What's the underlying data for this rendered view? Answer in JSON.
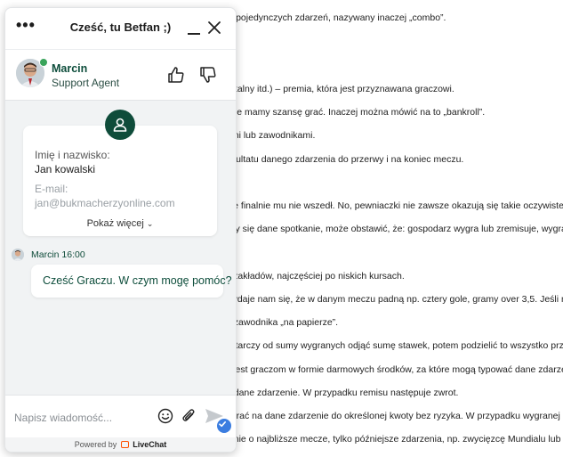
{
  "article": {
    "lines": [
      "le pojedynczych zdarzeń, nazywany inaczej „combo”.",
      "witalny itd.) – premia, która jest przyznawana graczowi.",
      "tóre mamy szansę grać. Inaczej można mówić na to „bankroll”.",
      "ami lub zawodnikami.",
      "ezultatu danego zdarzenia do przerwy i na koniec meczu.",
      "ale finalnie mu nie wszedł. No, pewniaczki nie zawsze okazują się takie oczywiste, jak",
      "czy się dane spotkanie, może obstawić, że: gospodarz wygra lub zremisuje, wygra gość",
      "ć zakładów, najczęściej po niskich kursach.",
      "wydaje nam się, że w danym meczu padną np. cztery gole, gramy over 3,5. Jeśli nat",
      "o zawodnika „na papierze”.",
      "ystarczy od sumy wygranych odjąć sumę stawek, potem podzielić to wszystko przez",
      "y jest graczom w formie darmowych środków, za które mogą typować dane zdarzen",
      "a dane zdarzenie. W przypadku remisu następuje zwrot.",
      "agrać na dane zdarzenie do określonej kwoty bez ryzyka. W przypadku wygranej salo",
      "g nie o najbliższe mecze, tylko późniejsze zdarzenia, np. zwycięzcę Mundialu lub króla"
    ]
  },
  "chat": {
    "title": "Cześć, tu Betfan ;)",
    "agent": {
      "name": "Marcin",
      "role": "Support Agent"
    },
    "form": {
      "name_label": "Imię i nazwisko:",
      "name_value": "Jan kowalski",
      "email_label": "E-mail:",
      "email_value": "jan@bukmacherzyonline.com",
      "show_more": "Pokaż więcej"
    },
    "message": {
      "author_time": "Marcin 16:00",
      "text": "Cześć Graczu. W czym mogę pomóc?"
    },
    "composer": {
      "placeholder": "Napisz wiadomość..."
    },
    "footer": {
      "powered_by": "Powered by",
      "brand": "LiveChat"
    },
    "colors": {
      "brand_green": "#0f4c3a",
      "online": "#3aa45b",
      "accent_blue": "#3b7de0",
      "livechat_orange": "#ff5100"
    }
  }
}
